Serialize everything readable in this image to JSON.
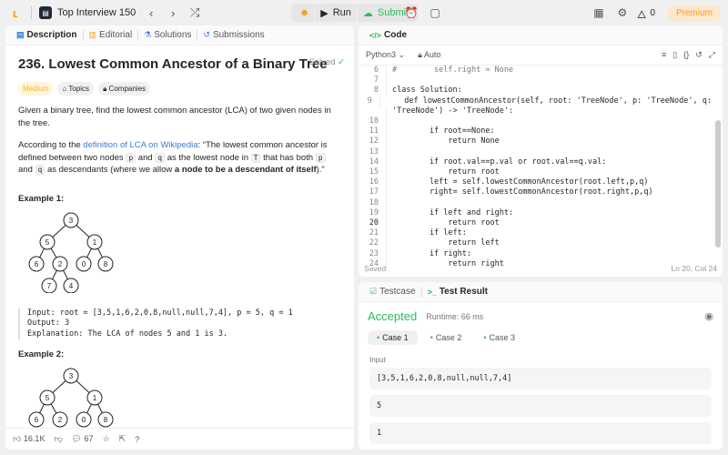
{
  "topbar": {
    "app_title": "Top Interview 150",
    "run_label": "Run",
    "submit_label": "Submit",
    "streak": "0",
    "premium_label": "Premium",
    "icons": [
      "logo",
      "problem-list",
      "chevron-left",
      "chevron-right",
      "shuffle",
      "bug",
      "run",
      "upload",
      "timer",
      "note",
      "layout",
      "gear",
      "fire"
    ]
  },
  "left": {
    "tabs": [
      {
        "label": "Description"
      },
      {
        "label": "Editorial"
      },
      {
        "label": "Solutions"
      },
      {
        "label": "Submissions"
      }
    ],
    "title": "236. Lowest Common Ancestor of a Binary Tree",
    "solved": "Solved",
    "chips": {
      "difficulty": "Medium",
      "topics": "Topics",
      "companies": "Companies"
    },
    "p1": "Given a binary tree, find the lowest common ancestor (LCA) of two given nodes in the tree.",
    "p2_a": "According to the ",
    "p2_link": "definition of LCA on Wikipedia",
    "p2_b": ": “The lowest common ancestor is defined between two nodes ",
    "p2_p": "p",
    "p2_c": " and ",
    "p2_q": "q",
    "p2_d": " as the lowest node in ",
    "p2_T": "T",
    "p2_e": " that has both ",
    "p2_f": " and ",
    "p2_g": " as descendants (where we allow ",
    "p2_bold": "a node to be a descendant of itself",
    "p2_h": ").”",
    "ex1_title": "Example 1:",
    "ex1_input": "Input: root = [3,5,1,6,2,0,8,null,null,7,4], p = 5, q = 1",
    "ex1_output": "Output: 3",
    "ex1_expl": "Explanation: The LCA of nodes 5 and 1 is 3.",
    "ex2_title": "Example 2:",
    "tree_nodes": [
      "3",
      "5",
      "1",
      "6",
      "2",
      "0",
      "8",
      "7",
      "4"
    ],
    "likes": "16.1K",
    "comments": "67"
  },
  "editor": {
    "header": "Code",
    "language": "Python3",
    "mode": "Auto",
    "saved": "Saved",
    "cursor": "Ln 20, Col 24",
    "lines": [
      {
        "n": "6",
        "t": "#        self.right = None"
      },
      {
        "n": "7",
        "t": ""
      },
      {
        "n": "8",
        "t": "class Solution:"
      },
      {
        "n": "9",
        "t": "    def lowestCommonAncestor(self, root: 'TreeNode', p: 'TreeNode', q:"
      },
      {
        "n": "",
        "t": "'TreeNode') -> 'TreeNode':"
      },
      {
        "n": "10",
        "t": ""
      },
      {
        "n": "11",
        "t": "        if root==None:"
      },
      {
        "n": "12",
        "t": "            return None"
      },
      {
        "n": "13",
        "t": ""
      },
      {
        "n": "14",
        "t": "        if root.val==p.val or root.val==q.val:"
      },
      {
        "n": "15",
        "t": "            return root"
      },
      {
        "n": "16",
        "t": "        left = self.lowestCommonAncestor(root.left,p,q)"
      },
      {
        "n": "17",
        "t": "        right= self.lowestCommonAncestor(root.right,p,q)"
      },
      {
        "n": "18",
        "t": ""
      },
      {
        "n": "19",
        "t": "        if left and right:"
      },
      {
        "n": "20",
        "t": "            return root"
      },
      {
        "n": "21",
        "t": "        if left:"
      },
      {
        "n": "22",
        "t": "            return left"
      },
      {
        "n": "23",
        "t": "        if right:"
      },
      {
        "n": "24",
        "t": "            return right"
      }
    ]
  },
  "result": {
    "tab_testcase": "Testcase",
    "tab_result": "Test Result",
    "status": "Accepted",
    "runtime": "Runtime: 66 ms",
    "cases": [
      "Case 1",
      "Case 2",
      "Case 3"
    ],
    "input_label": "Input",
    "values": [
      "[3,5,1,6,2,0,8,null,null,7,4]",
      "5",
      "1"
    ]
  },
  "colors": {
    "accent": "#2cbb5d",
    "brand": "#f89f1b",
    "link": "#3a7bd5"
  }
}
